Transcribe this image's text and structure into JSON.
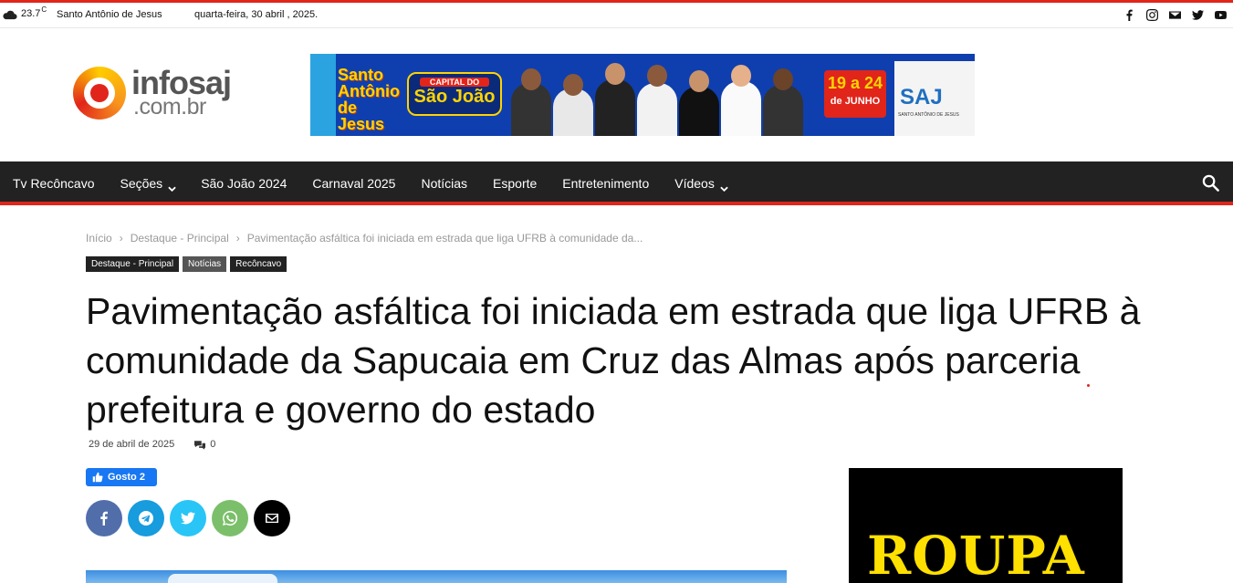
{
  "topbar": {
    "temperature": "23.7",
    "temperature_unit": "C",
    "weather_icon": "cloudy-icon",
    "city": "Santo Antônio de Jesus",
    "date": "quarta-feira, 30 abril , 2025.",
    "social_icons": [
      "facebook-icon",
      "instagram-icon",
      "email-icon",
      "twitter-icon",
      "youtube-icon"
    ]
  },
  "logo": {
    "line1": "infosaj",
    "line2": ".com.br"
  },
  "banner": {
    "title": "Santo Antônio de Jesus",
    "capital_label": "CAPITAL DO",
    "sao_joao": "São João",
    "dates": "19 a 24",
    "month": "de JUNHO",
    "brand": "SAJ",
    "brand_sub": "SANTO ANTÔNIO DE JESUS"
  },
  "nav": {
    "items": [
      {
        "label": "Tv Recôncavo",
        "has_dropdown": false
      },
      {
        "label": "Seções",
        "has_dropdown": true
      },
      {
        "label": "São João 2024",
        "has_dropdown": false
      },
      {
        "label": "Carnaval 2025",
        "has_dropdown": false
      },
      {
        "label": "Notícias",
        "has_dropdown": false
      },
      {
        "label": "Esporte",
        "has_dropdown": false
      },
      {
        "label": "Entretenimento",
        "has_dropdown": false
      },
      {
        "label": "Vídeos",
        "has_dropdown": true
      }
    ],
    "search_icon": "search-icon"
  },
  "breadcrumb": {
    "items": [
      "Início",
      "Destaque - Principal",
      "Pavimentação asfáltica foi iniciada em estrada que liga UFRB à comunidade da..."
    ],
    "separator": "›"
  },
  "categories": [
    "Destaque - Principal",
    "Notícias",
    "Recôncavo"
  ],
  "article": {
    "title": "Pavimentação asfáltica foi iniciada em estrada que liga UFRB à comunidade da Sapucaia em Cruz das Almas após parceria prefeitura e governo do estado",
    "date": "29 de abril de 2025",
    "comments": "0"
  },
  "like_button": {
    "label": "Gosto 2"
  },
  "share": [
    "facebook-icon",
    "telegram-icon",
    "twitter-icon",
    "whatsapp-icon",
    "email-icon"
  ],
  "ad": {
    "text": "ROUPA"
  },
  "colors": {
    "accent": "#e1251b",
    "nav_bg": "#222222",
    "like_blue": "#1877f2"
  }
}
